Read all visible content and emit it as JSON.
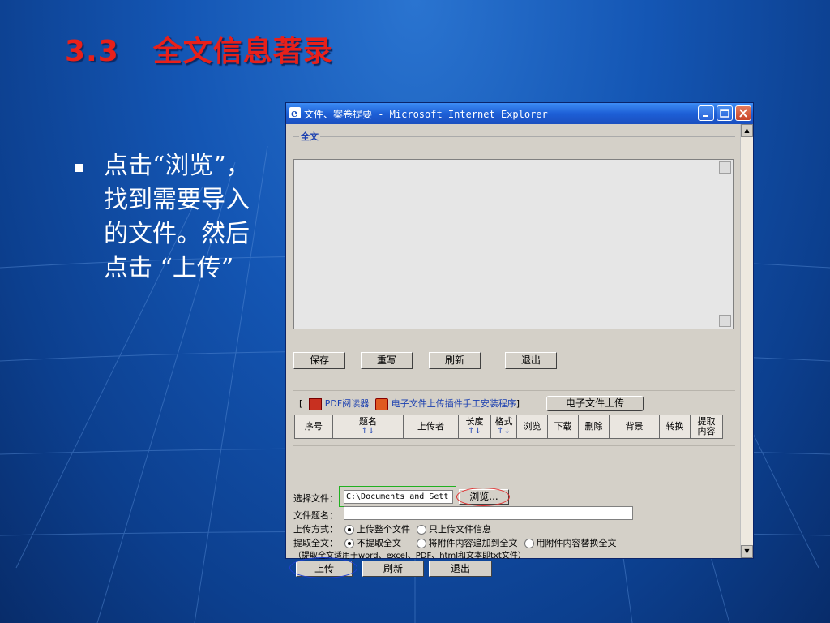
{
  "slide": {
    "title_num": "3.3",
    "title_text": "全文信息著录",
    "bullet": [
      "点击“浏览”，",
      "找到需要导入",
      "的文件。然后",
      "点击 “上传”"
    ],
    "colors": {
      "title": "#e8201a",
      "background": "#1456b4"
    }
  },
  "window": {
    "title": "文件、案卷提要 - Microsoft Internet Explorer",
    "icon": "ie-icon",
    "controls": {
      "minimize": "minimize-icon",
      "maximize": "maximize-icon",
      "close": "close-icon"
    },
    "fieldset_legend": "全文",
    "buttons_top": [
      "保存",
      "重写",
      "刷新",
      "退出"
    ],
    "links": {
      "bracket_open": "[",
      "pdf_reader": "PDF阅读器",
      "plugin_install": "电子文件上传插件手工安装程序",
      "bracket_close": "]",
      "upload_button": "电子文件上传"
    },
    "table_headers": [
      {
        "label": "序号",
        "sub": ""
      },
      {
        "label": "题名",
        "sub": "↑↓"
      },
      {
        "label": "上传者",
        "sub": ""
      },
      {
        "label": "长度",
        "sub": "↑↓"
      },
      {
        "label": "格式",
        "sub": "↑↓"
      },
      {
        "label": "浏览",
        "sub": ""
      },
      {
        "label": "下载",
        "sub": ""
      },
      {
        "label": "删除",
        "sub": ""
      },
      {
        "label": "背景",
        "sub": ""
      },
      {
        "label": "转换",
        "sub": ""
      },
      {
        "label": "提取",
        "sub": "内容"
      }
    ],
    "form": {
      "select_file_label": "选择文件：",
      "select_file_value": "C:\\Documents and Sett",
      "browse_button": "浏览...",
      "file_title_label": "文件题名：",
      "file_title_value": "",
      "upload_mode_label": "上传方式：",
      "upload_mode_options": [
        "上传整个文件",
        "只上传文件信息"
      ],
      "extract_label": "提取全文：",
      "extract_options": [
        "不提取全文",
        "将附件内容追加到全文",
        "用附件内容替换全文"
      ],
      "note": "（提取全文适用于word、excel、PDF、html和文本即txt文件）"
    },
    "buttons_bottom": [
      "上传",
      "刷新",
      "退出"
    ]
  }
}
